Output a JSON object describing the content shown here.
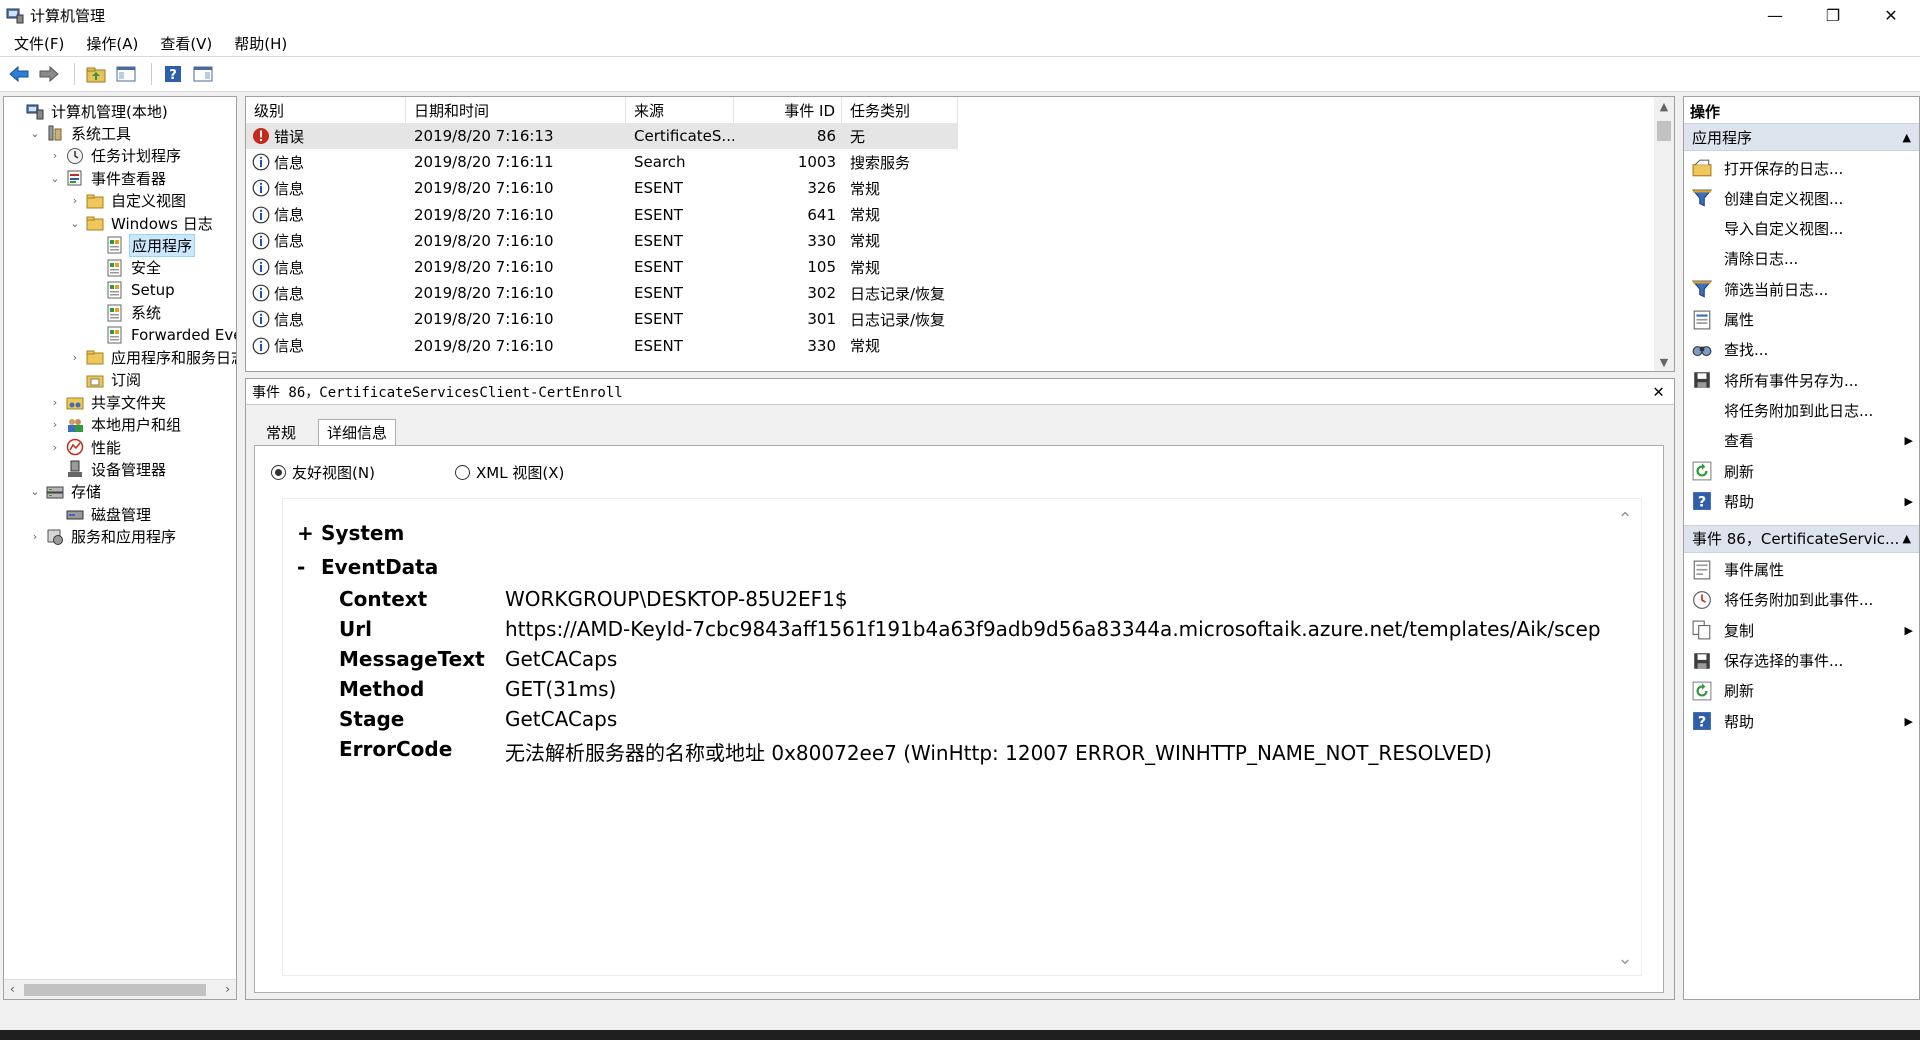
{
  "window": {
    "title": "计算机管理",
    "minimize": "—",
    "maximize": "❐",
    "close": "✕"
  },
  "menu": [
    "文件(F)",
    "操作(A)",
    "查看(V)",
    "帮助(H)"
  ],
  "toolbar": {
    "icons": [
      "back-icon",
      "forward-icon",
      "up-folder-icon",
      "show-hide-console-tree-icon",
      "help-icon",
      "show-hide-action-pane-icon"
    ]
  },
  "tree": {
    "items": [
      {
        "label": "计算机管理(本地)",
        "level": 0,
        "twisty": "",
        "icon": "computer-management-icon",
        "selected": false
      },
      {
        "label": "系统工具",
        "level": 1,
        "twisty": "⌄",
        "icon": "system-tools-icon",
        "selected": false
      },
      {
        "label": "任务计划程序",
        "level": 2,
        "twisty": "›",
        "icon": "task-scheduler-icon",
        "selected": false
      },
      {
        "label": "事件查看器",
        "level": 2,
        "twisty": "⌄",
        "icon": "event-viewer-icon",
        "selected": false
      },
      {
        "label": "自定义视图",
        "level": 3,
        "twisty": "›",
        "icon": "folder-icon",
        "selected": false
      },
      {
        "label": "Windows 日志",
        "level": 3,
        "twisty": "⌄",
        "icon": "folder-icon",
        "selected": false
      },
      {
        "label": "应用程序",
        "level": 4,
        "twisty": "",
        "icon": "log-icon",
        "selected": true
      },
      {
        "label": "安全",
        "level": 4,
        "twisty": "",
        "icon": "log-icon",
        "selected": false
      },
      {
        "label": "Setup",
        "level": 4,
        "twisty": "",
        "icon": "log-icon",
        "selected": false
      },
      {
        "label": "系统",
        "level": 4,
        "twisty": "",
        "icon": "log-icon",
        "selected": false
      },
      {
        "label": "Forwarded Even",
        "level": 4,
        "twisty": "",
        "icon": "log-icon",
        "selected": false
      },
      {
        "label": "应用程序和服务日志",
        "level": 3,
        "twisty": "›",
        "icon": "folder-icon",
        "selected": false
      },
      {
        "label": "订阅",
        "level": 3,
        "twisty": "",
        "icon": "subscription-icon",
        "selected": false
      },
      {
        "label": "共享文件夹",
        "level": 2,
        "twisty": "›",
        "icon": "shared-folder-icon",
        "selected": false
      },
      {
        "label": "本地用户和组",
        "level": 2,
        "twisty": "›",
        "icon": "users-icon",
        "selected": false
      },
      {
        "label": "性能",
        "level": 2,
        "twisty": "›",
        "icon": "performance-icon",
        "selected": false
      },
      {
        "label": "设备管理器",
        "level": 2,
        "twisty": "",
        "icon": "device-manager-icon",
        "selected": false
      },
      {
        "label": "存储",
        "level": 1,
        "twisty": "⌄",
        "icon": "storage-icon",
        "selected": false
      },
      {
        "label": "磁盘管理",
        "level": 2,
        "twisty": "",
        "icon": "disk-management-icon",
        "selected": false
      },
      {
        "label": "服务和应用程序",
        "level": 1,
        "twisty": "›",
        "icon": "services-icon",
        "selected": false
      }
    ],
    "scroll_left": "‹",
    "scroll_right": "›"
  },
  "events": {
    "columns": [
      "级别",
      "日期和时间",
      "来源",
      "事件 ID",
      "任务类别"
    ],
    "rows": [
      {
        "level": "错误",
        "type": "error",
        "datetime": "2019/8/20 7:16:13",
        "source": "CertificateS...",
        "id": "86",
        "category": "无"
      },
      {
        "level": "信息",
        "type": "info",
        "datetime": "2019/8/20 7:16:11",
        "source": "Search",
        "id": "1003",
        "category": "搜索服务"
      },
      {
        "level": "信息",
        "type": "info",
        "datetime": "2019/8/20 7:16:10",
        "source": "ESENT",
        "id": "326",
        "category": "常规"
      },
      {
        "level": "信息",
        "type": "info",
        "datetime": "2019/8/20 7:16:10",
        "source": "ESENT",
        "id": "641",
        "category": "常规"
      },
      {
        "level": "信息",
        "type": "info",
        "datetime": "2019/8/20 7:16:10",
        "source": "ESENT",
        "id": "330",
        "category": "常规"
      },
      {
        "level": "信息",
        "type": "info",
        "datetime": "2019/8/20 7:16:10",
        "source": "ESENT",
        "id": "105",
        "category": "常规"
      },
      {
        "level": "信息",
        "type": "info",
        "datetime": "2019/8/20 7:16:10",
        "source": "ESENT",
        "id": "302",
        "category": "日志记录/恢复"
      },
      {
        "level": "信息",
        "type": "info",
        "datetime": "2019/8/20 7:16:10",
        "source": "ESENT",
        "id": "301",
        "category": "日志记录/恢复"
      },
      {
        "level": "信息",
        "type": "info",
        "datetime": "2019/8/20 7:16:10",
        "source": "ESENT",
        "id": "330",
        "category": "常规"
      }
    ]
  },
  "detail": {
    "header": "事件 86，CertificateServicesClient-CertEnroll",
    "close": "✕",
    "tabs": [
      "常规",
      "详细信息"
    ],
    "active_tab": 1,
    "view_options": [
      "友好视图(N)",
      "XML 视图(X)"
    ],
    "selected_view": 0,
    "sections": [
      {
        "sign": "+",
        "label": "System"
      },
      {
        "sign": "-",
        "label": "EventData"
      }
    ],
    "event_data": [
      {
        "key": "Context",
        "value": "WORKGROUP\\DESKTOP-85U2EF1$"
      },
      {
        "key": "Url",
        "value": "https://AMD-KeyId-7cbc9843aff1561f191b4a63f9adb9d56a83344a.microsoftaik.azure.net/templates/Aik/scep"
      },
      {
        "key": "MessageText",
        "value": "GetCACaps"
      },
      {
        "key": "Method",
        "value": "GET(31ms)"
      },
      {
        "key": "Stage",
        "value": "GetCACaps"
      },
      {
        "key": "ErrorCode",
        "value": "无法解析服务器的名称或地址 0x80072ee7 (WinHttp: 12007 ERROR_WINHTTP_NAME_NOT_RESOLVED)"
      }
    ]
  },
  "actions": {
    "title": "操作",
    "groups": [
      {
        "label": "应用程序",
        "items": [
          {
            "label": "打开保存的日志...",
            "icon": "open-log-icon",
            "submenu": false
          },
          {
            "label": "创建自定义视图...",
            "icon": "filter-icon",
            "submenu": false
          },
          {
            "label": "导入自定义视图...",
            "icon": "",
            "submenu": false
          },
          {
            "label": "清除日志...",
            "icon": "",
            "submenu": false
          },
          {
            "label": "筛选当前日志...",
            "icon": "filter-icon",
            "submenu": false
          },
          {
            "label": "属性",
            "icon": "properties-icon",
            "submenu": false
          },
          {
            "label": "查找...",
            "icon": "find-icon",
            "submenu": false
          },
          {
            "label": "将所有事件另存为...",
            "icon": "save-icon",
            "submenu": false
          },
          {
            "label": "将任务附加到此日志...",
            "icon": "",
            "submenu": false
          },
          {
            "label": "查看",
            "icon": "",
            "submenu": true
          },
          {
            "label": "刷新",
            "icon": "refresh-icon",
            "submenu": false
          },
          {
            "label": "帮助",
            "icon": "help-icon",
            "submenu": true
          }
        ]
      },
      {
        "label": "事件 86，CertificateServic...",
        "items": [
          {
            "label": "事件属性",
            "icon": "event-properties-icon",
            "submenu": false
          },
          {
            "label": "将任务附加到此事件...",
            "icon": "task-icon",
            "submenu": false
          },
          {
            "label": "复制",
            "icon": "copy-icon",
            "submenu": true
          },
          {
            "label": "保存选择的事件...",
            "icon": "save-icon",
            "submenu": false
          },
          {
            "label": "刷新",
            "icon": "refresh-icon",
            "submenu": false
          },
          {
            "label": "帮助",
            "icon": "help-icon",
            "submenu": true
          }
        ]
      }
    ],
    "collapse_glyph": "▲",
    "submenu_glyph": "▶"
  },
  "colors": {
    "selection": "#cce8ff",
    "error": "#c42b1c",
    "info_blue": "#1a56b0",
    "section_header": "#dde4ee"
  }
}
